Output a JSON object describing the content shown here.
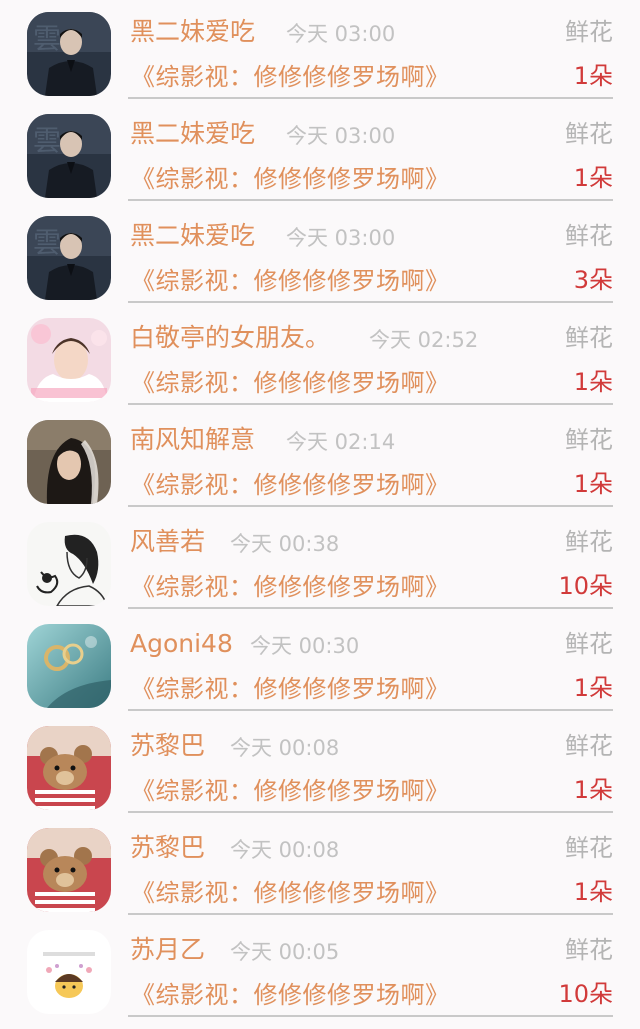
{
  "rows": [
    {
      "name": "黑二妹爱吃",
      "time": "今天 03:00",
      "gift": "鲜花",
      "book": "《综影视：修修修修罗场啊》",
      "count": "1朵",
      "avatar_icon": "dark-suit-man-avatar-icon"
    },
    {
      "name": "黑二妹爱吃",
      "time": "今天 03:00",
      "gift": "鲜花",
      "book": "《综影视：修修修修罗场啊》",
      "count": "1朵",
      "avatar_icon": "dark-suit-man-avatar-icon"
    },
    {
      "name": "黑二妹爱吃",
      "time": "今天 03:00",
      "gift": "鲜花",
      "book": "《综影视：修修修修罗场啊》",
      "count": "3朵",
      "avatar_icon": "dark-suit-man-avatar-icon"
    },
    {
      "name": "白敬亭的女朋友。",
      "time": "今天 02:52",
      "gift": "鲜花",
      "book": "《综影视：修修修修罗场啊》",
      "count": "1朵",
      "avatar_icon": "pink-portrait-avatar-icon"
    },
    {
      "name": "南风知解意",
      "time": "今天 02:14",
      "gift": "鲜花",
      "book": "《综影视：修修修修罗场啊》",
      "count": "1朵",
      "avatar_icon": "veiled-woman-avatar-icon"
    },
    {
      "name": "风善若",
      "time": "今天 00:38",
      "gift": "鲜花",
      "book": "《综影视：修修修修罗场啊》",
      "count": "10朵",
      "avatar_icon": "ink-sketch-avatar-icon"
    },
    {
      "name": "Agoni48",
      "time": "今天 00:30",
      "gift": "鲜花",
      "book": "《综影视：修修修修罗场啊》",
      "count": "1朵",
      "avatar_icon": "rings-avatar-icon"
    },
    {
      "name": "苏黎巴",
      "time": "今天 00:08",
      "gift": "鲜花",
      "book": "《综影视：修修修修罗场啊》",
      "count": "1朵",
      "avatar_icon": "teddy-bear-avatar-icon"
    },
    {
      "name": "苏黎巴",
      "time": "今天 00:08",
      "gift": "鲜花",
      "book": "《综影视：修修修修罗场啊》",
      "count": "1朵",
      "avatar_icon": "teddy-bear-avatar-icon"
    },
    {
      "name": "苏月乙",
      "time": "今天 00:05",
      "gift": "鲜花",
      "book": "《综影视：修修修修罗场啊》",
      "count": "10朵",
      "avatar_icon": "cartoon-chick-avatar-icon"
    }
  ],
  "colors": {
    "name": "#e0905c",
    "count": "#d13a3a",
    "time": "#c2c2c2",
    "gift": "#b4b4b4"
  }
}
